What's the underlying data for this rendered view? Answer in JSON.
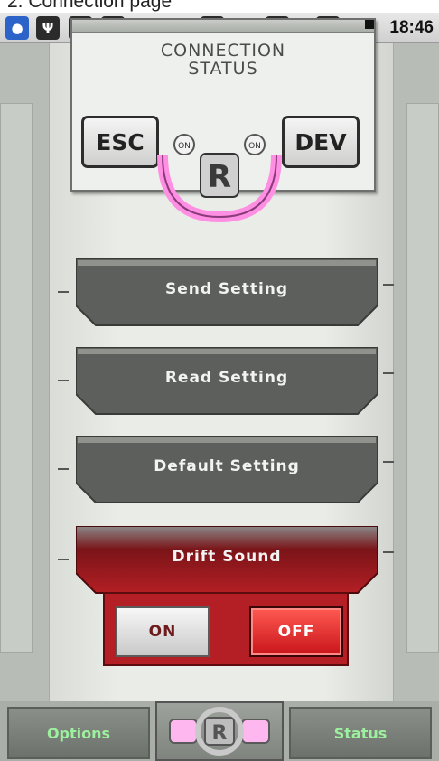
{
  "caption": "2.   Connection page",
  "status_bar": {
    "time": "18:46",
    "icons": [
      "app-icon",
      "usb-icon",
      "android-icon",
      "wifi-icon",
      "bluetooth-icon",
      "vibrate-icon",
      "sim-icon",
      "signal-icon",
      "battery-icon"
    ]
  },
  "connection_status": {
    "title_line1": "CONNECTION",
    "title_line2": "STATUS",
    "esc_label": "ESC",
    "dev_label": "DEV",
    "left_node": "ON",
    "right_node": "ON",
    "logo_letter": "R"
  },
  "buttons": {
    "send": "Send Setting",
    "read": "Read Setting",
    "default": "Default Setting",
    "drift": "Drift Sound"
  },
  "drift_toggle": {
    "on_label": "ON",
    "off_label": "OFF",
    "selected": "OFF"
  },
  "bottom_nav": {
    "options": "Options",
    "status": "Status",
    "logo_letter": "R"
  },
  "colors": {
    "accent_red": "#b31f24",
    "pink": "#ff8fe3",
    "nav_text": "#9df09d"
  }
}
